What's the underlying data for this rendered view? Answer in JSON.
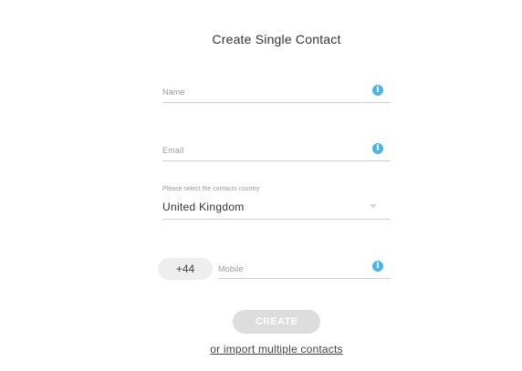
{
  "form": {
    "title": "Create Single Contact",
    "name": {
      "placeholder": "Name",
      "info_icon": "info-icon"
    },
    "email": {
      "placeholder": "Email",
      "info_icon": "info-icon"
    },
    "country": {
      "hint": "Please select the contacts country",
      "selected": "United Kingdom",
      "caret_icon": "chevron-down-icon"
    },
    "mobile": {
      "country_code": "+44",
      "placeholder": "Mobile",
      "info_icon": "info-icon"
    },
    "create_label": "CREATE",
    "import_link": "or import multiple contacts"
  },
  "colors": {
    "info": "#4fb3e6",
    "button_disabled": "#dddddd",
    "pill": "#eeeeee"
  }
}
